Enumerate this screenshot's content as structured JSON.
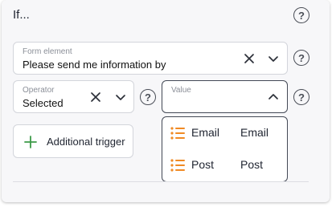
{
  "header": {
    "title": "If..."
  },
  "form_element": {
    "label": "Form element",
    "value": "Please send me information by"
  },
  "operator": {
    "label": "Operator",
    "value": "Selected"
  },
  "value_field": {
    "placeholder": "Value",
    "options": [
      {
        "label": "Email",
        "value": "Email",
        "icon": "list-icon"
      },
      {
        "label": "Post",
        "value": "Post",
        "icon": "list-icon"
      }
    ]
  },
  "trigger": {
    "label": "Additional trigger",
    "icon": "plus-icon"
  },
  "colors": {
    "accent_list": "#f08a24",
    "plus_green": "#3c9a48",
    "border_active": "#444956"
  }
}
